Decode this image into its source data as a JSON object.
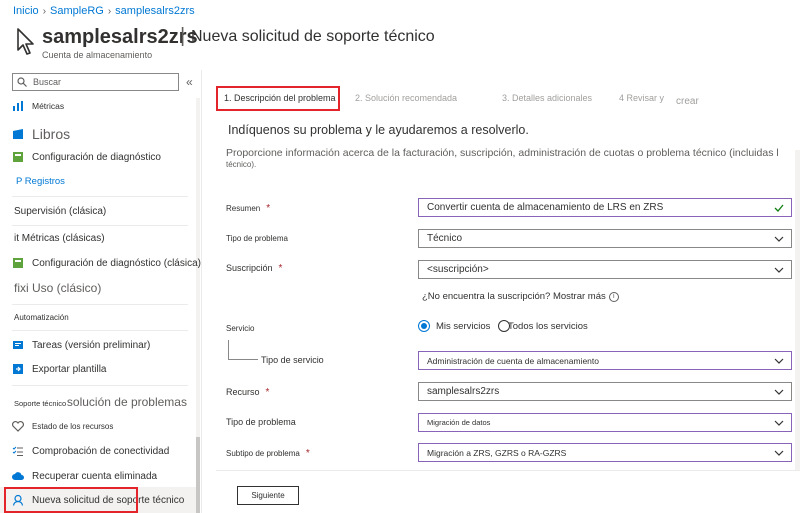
{
  "breadcrumb": [
    "Inicio",
    "SampleRG",
    "samplesalrs2zrs"
  ],
  "title": {
    "resource": "samplesalrs2zrs",
    "page": "Nueva solicitud de soporte técnico",
    "subtitle": "Cuenta de almacenamiento"
  },
  "sidebar": {
    "search_placeholder": "Buscar",
    "collapse": "«",
    "items": {
      "metricas": "Métricas",
      "libros": "Libros",
      "config_diag": "Configuración de diagnóstico",
      "registros": "P Registros",
      "supervision_head": "Supervisión (clásica)",
      "metricas_clasicas": "it Métricas (clásicas)",
      "config_diag_clasica": "Configuración de diagnóstico (clásica)",
      "uso_clasico": "fixi Uso (clásico)",
      "automatizacion_head": "Automatización",
      "tareas": "Tareas (versión preliminar)",
      "exportar": "Exportar plantilla",
      "soporte_head_a": "Soporte técnico",
      "soporte_head_b": "solución de problemas",
      "estado": "Estado de los recursos",
      "conectividad": "Comprobación de conectividad",
      "recuperar": "Recuperar cuenta eliminada",
      "nueva_solicitud": "Nueva solicitud de soporte técnico"
    }
  },
  "steps": [
    "1. Descripción del problema",
    "2. Solución recomendada",
    "3. Detalles adicionales",
    "4 Revisar y",
    "crear"
  ],
  "form": {
    "intro": "Indíquenos su problema y le ayudaremos a resolverlo.",
    "desc": "Proporcione información acerca de la facturación, suscripción, administración de cuotas o problema técnico (incluidas l",
    "desc2": "técnico).",
    "resumen_label": "Resumen",
    "resumen_value": "Convertir cuenta de almacenamiento de LRS en ZRS",
    "tipo_problema_label": "Tipo de problema",
    "tipo_problema_value": "Técnico",
    "suscripcion_label": "Suscripción",
    "suscripcion_value": "<suscripción>",
    "helper": "¿No encuentra la suscripción? Mostrar más",
    "servicio_label": "Servicio",
    "radio_mis": "Mis servicios",
    "radio_todos": "Todos los servicios",
    "tipo_servicio_label": "Tipo de servicio",
    "tipo_servicio_value": "Administración de cuenta de almacenamiento",
    "recurso_label": "Recurso",
    "recurso_value": "samplesalrs2zrs",
    "tipo_problema2_label": "Tipo de problema",
    "tipo_problema2_value": "Migración de datos",
    "subtipo_label": "Subtipo de problema",
    "subtipo_value": "Migración a ZRS, GZRS o RA-GZRS",
    "required_mark": "*",
    "info_mark": "i",
    "next": "Siguiente"
  },
  "colors": {
    "accent": "#0078d4",
    "highlight_red": "#e3242b",
    "field_purple": "#8764b8",
    "valid_green": "#107c10"
  }
}
